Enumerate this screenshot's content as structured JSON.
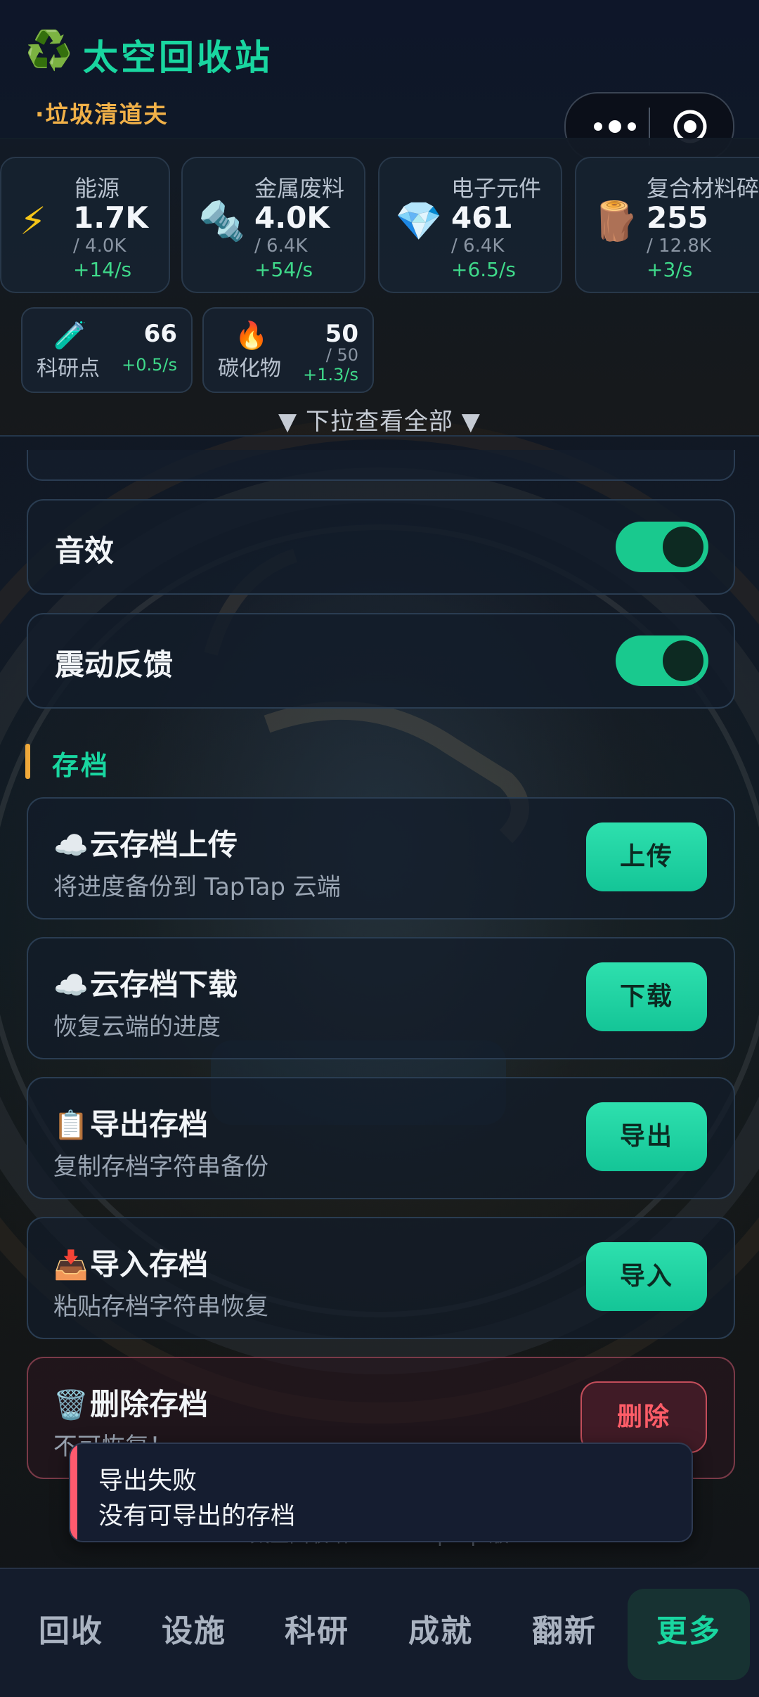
{
  "header": {
    "logo_icon": "♻️",
    "title": "太空回收站",
    "subtitle": "·垃圾清道夫"
  },
  "capsule": {
    "more_icon": "more-dots-icon",
    "target_icon": "target-icon"
  },
  "resources": [
    {
      "icon": "⚡",
      "name": "能源",
      "value": "1.7K",
      "cap": "/ 4.0K",
      "rate": "+14/s"
    },
    {
      "icon": "🔩",
      "name": "金属废料",
      "value": "4.0K",
      "cap": "/ 6.4K",
      "rate": "+54/s"
    },
    {
      "icon": "💎",
      "name": "电子元件",
      "value": "461",
      "cap": "/ 6.4K",
      "rate": "+6.5/s"
    },
    {
      "icon": "🪵",
      "name": "复合材料碎",
      "value": "255",
      "cap": "/ 12.8K",
      "rate": "+3/s"
    }
  ],
  "small_resources": [
    {
      "icon": "🧪",
      "name": "科研点",
      "value": "66",
      "cap": "",
      "rate": "+0.5/s"
    },
    {
      "icon": "🔥",
      "name": "碳化物",
      "value": "50",
      "cap": "/ 50",
      "rate": "+1.3/s"
    }
  ],
  "pull_hint": "▼ 下拉查看全部 ▼",
  "settings": [
    {
      "label": "音效",
      "enabled": true
    },
    {
      "label": "震动反馈",
      "enabled": true
    }
  ],
  "section": {
    "title": "存档"
  },
  "saves": [
    {
      "icon": "☁️",
      "title": "云存档上传",
      "desc": "将进度备份到 TapTap 云端",
      "button": "上传"
    },
    {
      "icon": "☁️",
      "title": "云存档下载",
      "desc": "恢复云端的进度",
      "button": "下载"
    },
    {
      "icon": "📋",
      "title": "导出存档",
      "desc": "复制存档字符串备份",
      "button": "导出"
    },
    {
      "icon": "📥",
      "title": "导入存档",
      "desc": "粘贴存档字符串恢复",
      "button": "导入"
    },
    {
      "icon": "🗑️",
      "title": "删除存档",
      "desc": "不可恢复！",
      "button": "删除"
    }
  ],
  "footer": "太空回收站 v1.0 · TapTap 版",
  "toast": {
    "title": "导出失败",
    "message": "没有可导出的存档"
  },
  "nav": [
    {
      "label": "回收"
    },
    {
      "label": "设施"
    },
    {
      "label": "科研"
    },
    {
      "label": "成就"
    },
    {
      "label": "翻新"
    },
    {
      "label": "更多"
    }
  ],
  "colors": {
    "accent": "#19d6a0",
    "warning": "#f0a93a",
    "danger": "#ff5a6e"
  }
}
